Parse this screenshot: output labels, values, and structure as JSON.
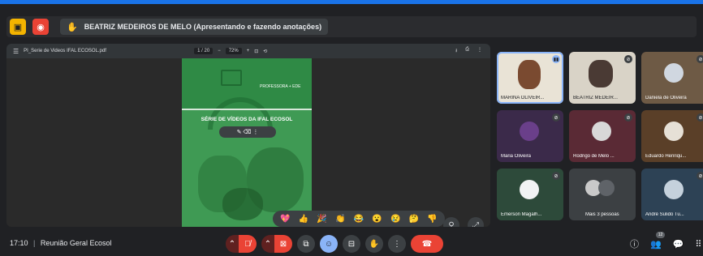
{
  "banner": {
    "presenter_text": "BEATRIZ MEDEIROS DE MELO (Apresentando e fazendo anotações)",
    "left_icon": "sticky-note-icon",
    "stop_icon": "stop-presenting-icon"
  },
  "pdf_viewer": {
    "filename": "PI_Serie de Videos IFAL ECOSOL.pdf",
    "page_indicator": "1 / 20",
    "zoom": "72%",
    "page": {
      "header_label": "PROFESSORA + EDE",
      "series_title": "SÉRIE DE VÍDEOS DA IFAL ECOSOL"
    }
  },
  "reactions": [
    "💖",
    "👍",
    "🎉",
    "👏",
    "😂",
    "😮",
    "😢",
    "🤔",
    "👎"
  ],
  "participants": [
    {
      "name": "MARINA OLIVEIR...",
      "mic": "speaking"
    },
    {
      "name": "BEATRIZ MEDEIR...",
      "mic": "muted"
    },
    {
      "name": "Daniela de Oliveira",
      "mic": "muted"
    },
    {
      "name": "Maria Oliveira",
      "mic": "muted"
    },
    {
      "name": "Rodrigo de Melo ...",
      "mic": "muted"
    },
    {
      "name": "Eduardo Henriqu...",
      "mic": "muted"
    },
    {
      "name": "Emerson Magalh...",
      "mic": "muted"
    },
    {
      "name": "Mais 3 pessoas",
      "mic": "none"
    },
    {
      "name": "André Sulido Tu...",
      "mic": "muted"
    }
  ],
  "bottom": {
    "time": "17:10",
    "separator": "|",
    "meeting_name": "Reunião Geral Ecosol",
    "people_count": "12"
  },
  "colors": {
    "accent": "#8ab4f8",
    "danger": "#ea4335",
    "background": "#202124",
    "page_green": "#3f9a54"
  }
}
